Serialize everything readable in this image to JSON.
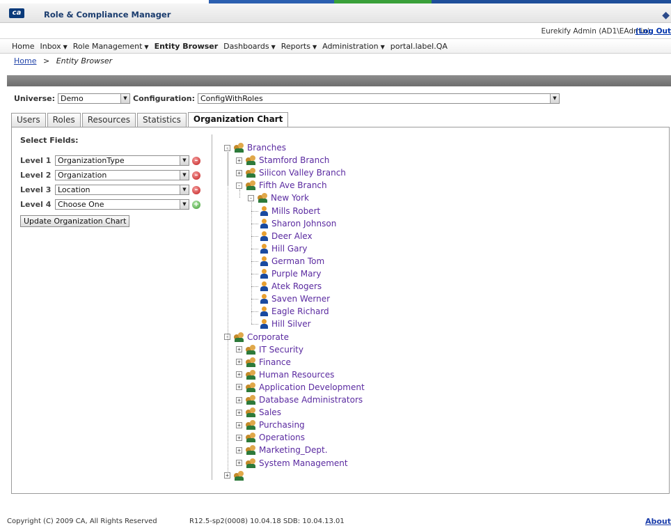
{
  "app": {
    "title": "Role & Compliance Manager",
    "logo_text": "ca",
    "accent": "#1a3c6e"
  },
  "user": {
    "info": "Eurekify Admin (AD1\\EAdmin)",
    "logout": "(Log Out"
  },
  "menu": [
    {
      "label": "Home",
      "dropdown": false,
      "active": false
    },
    {
      "label": "Inbox",
      "dropdown": true,
      "active": false
    },
    {
      "label": "Role Management",
      "dropdown": true,
      "active": false
    },
    {
      "label": "Entity Browser",
      "dropdown": false,
      "active": true
    },
    {
      "label": "Dashboards",
      "dropdown": true,
      "active": false
    },
    {
      "label": "Reports",
      "dropdown": true,
      "active": false
    },
    {
      "label": "Administration",
      "dropdown": true,
      "active": false
    },
    {
      "label": "portal.label.QA",
      "dropdown": false,
      "active": false
    }
  ],
  "breadcrumb": {
    "home": "Home",
    "separator": ">",
    "current": "Entity Browser"
  },
  "selectors": {
    "universe_label": "Universe:",
    "universe_value": "Demo",
    "configuration_label": "Configuration:",
    "configuration_value": "ConfigWithRoles"
  },
  "tabs": [
    "Users",
    "Roles",
    "Resources",
    "Statistics",
    "Organization Chart"
  ],
  "active_tab": "Organization Chart",
  "fields": {
    "heading": "Select Fields:",
    "levels": [
      {
        "label": "Level 1",
        "value": "OrganizationType",
        "action": "remove"
      },
      {
        "label": "Level 2",
        "value": "Organization",
        "action": "remove"
      },
      {
        "label": "Level 3",
        "value": "Location",
        "action": "remove"
      },
      {
        "label": "Level 4",
        "value": "Choose One",
        "action": "add"
      }
    ],
    "update_button": "Update Organization Chart"
  },
  "tree": [
    {
      "label": "Branches",
      "depth": 0,
      "type": "group",
      "state": "expanded"
    },
    {
      "label": "Stamford Branch",
      "depth": 1,
      "type": "group",
      "state": "collapsed"
    },
    {
      "label": "Silicon Valley Branch",
      "depth": 1,
      "type": "group",
      "state": "collapsed"
    },
    {
      "label": "Fifth Ave Branch",
      "depth": 1,
      "type": "group",
      "state": "expanded"
    },
    {
      "label": "New York",
      "depth": 2,
      "type": "group",
      "state": "expanded"
    },
    {
      "label": "Mills Robert",
      "depth": 3,
      "type": "user",
      "state": "leaf"
    },
    {
      "label": "Sharon Johnson",
      "depth": 3,
      "type": "user",
      "state": "leaf"
    },
    {
      "label": "Deer Alex",
      "depth": 3,
      "type": "user",
      "state": "leaf"
    },
    {
      "label": "Hill Gary",
      "depth": 3,
      "type": "user",
      "state": "leaf"
    },
    {
      "label": "German Tom",
      "depth": 3,
      "type": "user",
      "state": "leaf"
    },
    {
      "label": "Purple Mary",
      "depth": 3,
      "type": "user",
      "state": "leaf"
    },
    {
      "label": "Atek Rogers",
      "depth": 3,
      "type": "user",
      "state": "leaf"
    },
    {
      "label": "Saven Werner",
      "depth": 3,
      "type": "user",
      "state": "leaf"
    },
    {
      "label": "Eagle Richard",
      "depth": 3,
      "type": "user",
      "state": "leaf"
    },
    {
      "label": "Hill Silver",
      "depth": 3,
      "type": "user",
      "state": "leaf"
    },
    {
      "label": "Corporate",
      "depth": 0,
      "type": "group",
      "state": "expanded"
    },
    {
      "label": "IT Security",
      "depth": 1,
      "type": "group",
      "state": "collapsed"
    },
    {
      "label": "Finance",
      "depth": 1,
      "type": "group",
      "state": "collapsed"
    },
    {
      "label": "Human Resources",
      "depth": 1,
      "type": "group",
      "state": "collapsed"
    },
    {
      "label": "Application Development",
      "depth": 1,
      "type": "group",
      "state": "collapsed"
    },
    {
      "label": "Database Administrators",
      "depth": 1,
      "type": "group",
      "state": "collapsed"
    },
    {
      "label": "Sales",
      "depth": 1,
      "type": "group",
      "state": "collapsed"
    },
    {
      "label": "Purchasing",
      "depth": 1,
      "type": "group",
      "state": "collapsed"
    },
    {
      "label": "Operations",
      "depth": 1,
      "type": "group",
      "state": "collapsed"
    },
    {
      "label": "Marketing_Dept.",
      "depth": 1,
      "type": "group",
      "state": "collapsed"
    },
    {
      "label": "System Management",
      "depth": 1,
      "type": "group",
      "state": "collapsed"
    },
    {
      "label": "",
      "depth": 0,
      "type": "group",
      "state": "collapsed"
    }
  ],
  "footer": {
    "copyright": "Copyright (C) 2009 CA, All Rights Reserved",
    "version": "R12.5-sp2(0008) 10.04.18 SDB: 10.04.13.01",
    "about": "About"
  }
}
